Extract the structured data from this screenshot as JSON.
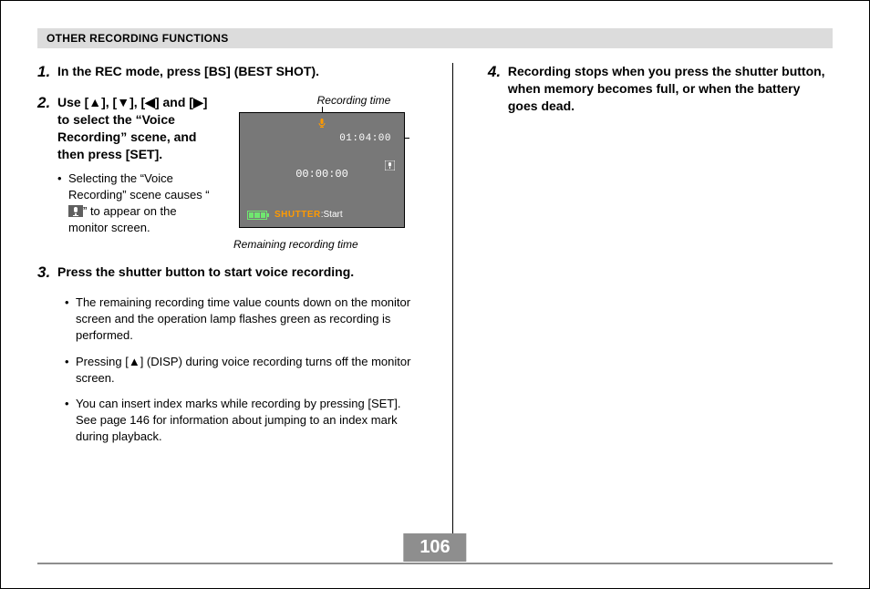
{
  "header": "OTHER RECORDING FUNCTIONS",
  "fig": {
    "topCaption": "Recording time",
    "remain": "01:04:00",
    "elapsed": "00:00:00",
    "shutterLabel": "SHUTTER",
    "shutterAction": ":Start",
    "bottomCaption": "Remaining recording time"
  },
  "steps": {
    "s1": {
      "num": "1.",
      "text": "In the REC mode, press [BS] (BEST SHOT)."
    },
    "s2": {
      "num": "2.",
      "textA": "Use [",
      "textB": "], [",
      "textC": "], [",
      "textD": "] and [",
      "textE": "] to select the “Voice Recording” scene, and then press [SET].",
      "bullet1a": "Selecting the “Voice Recording” scene causes “",
      "bullet1b": "” to appear on the monitor screen.",
      "arrowUp": "▲",
      "arrowDown": "▼",
      "arrowLeft": "◀",
      "arrowRight": "▶"
    },
    "s3": {
      "num": "3.",
      "text": "Press the shutter button to start voice recording.",
      "bullet1": "The remaining recording time value counts down on the monitor screen and the operation lamp flashes green as recording is performed.",
      "bullet2a": "Pressing [",
      "bullet2b": "] (DISP) during voice recording turns off the monitor screen.",
      "arrowUp": "▲",
      "bullet3": "You can insert index marks while recording by pressing [SET]. See page 146 for information about jumping to an index mark during playback."
    },
    "s4": {
      "num": "4.",
      "text": "Recording stops when you press the shutter button, when memory becomes full, or when the battery goes dead."
    }
  },
  "pageNumber": "106"
}
